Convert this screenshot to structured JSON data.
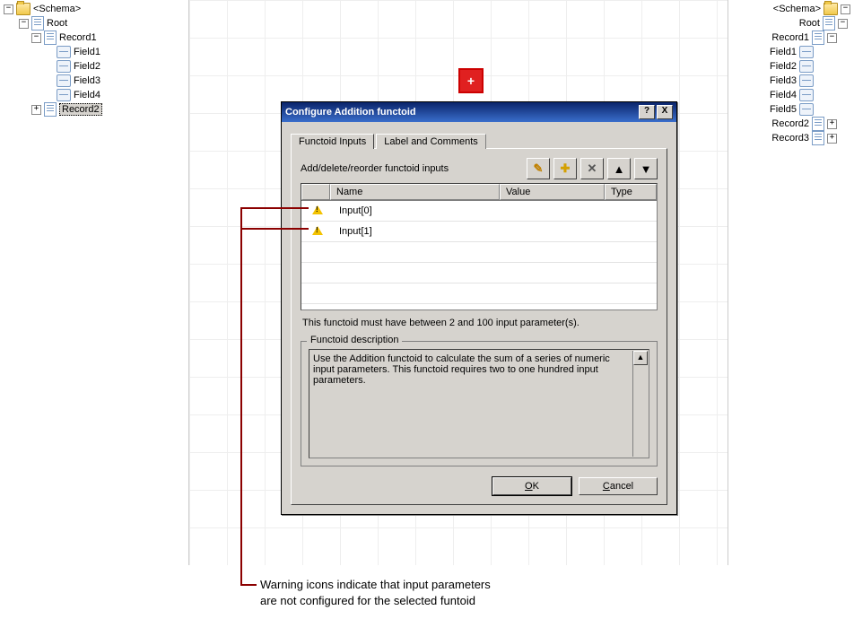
{
  "left_tree": {
    "schema": "<Schema>",
    "root": "Root",
    "record1": "Record1",
    "fields": [
      "Field1",
      "Field2",
      "Field3",
      "Field4"
    ],
    "record2": "Record2"
  },
  "right_tree": {
    "schema": "<Schema>",
    "root": "Root",
    "record1": "Record1",
    "fields": [
      "Field1",
      "Field2",
      "Field3",
      "Field4",
      "Field5"
    ],
    "record2": "Record2",
    "record3": "Record3"
  },
  "functoid_symbol": "+",
  "dialog": {
    "title": "Configure Addition functoid",
    "tabs": {
      "inputs": "Functoid Inputs",
      "label": "Label and Comments"
    },
    "instruction": "Add/delete/reorder functoid inputs",
    "toolbar": {
      "edit": "✎",
      "add": "✚",
      "delete": "✕",
      "up": "▲",
      "down": "▼"
    },
    "columns": {
      "icon": "",
      "name": "Name",
      "value": "Value",
      "type": "Type"
    },
    "rows": [
      {
        "name": "Input[0]"
      },
      {
        "name": "Input[1]"
      }
    ],
    "hint": "This functoid must have between 2 and 100 input parameter(s).",
    "desc_label": "Functoid description",
    "desc": "Use the Addition functoid to calculate the sum of a series of numeric input parameters. This functoid requires two to one hundred input parameters.",
    "ok_u": "O",
    "ok_rest": "K",
    "cancel_u": "C",
    "cancel_rest": "ancel",
    "help": "?",
    "close": "X"
  },
  "annotation": {
    "line1": "Warning icons indicate that input parameters",
    "line2": "are not configured for the selected funtoid"
  }
}
